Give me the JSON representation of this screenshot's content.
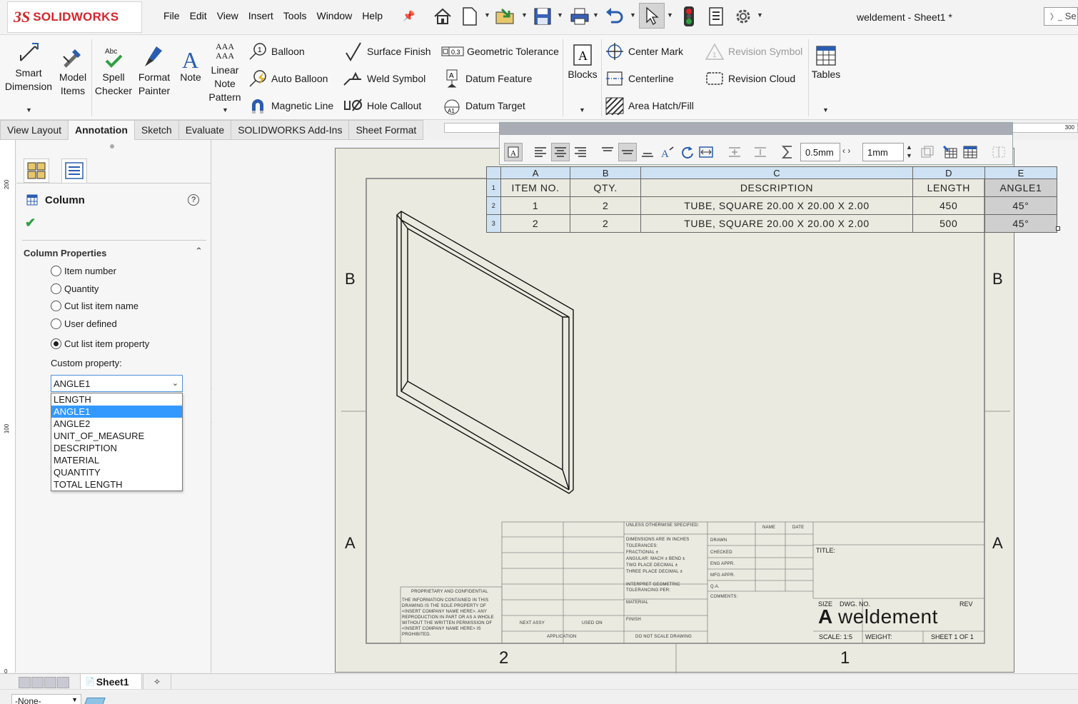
{
  "app": {
    "brand_mark": "3S",
    "brand": "SOLIDWORKS",
    "menu": [
      "File",
      "Edit",
      "View",
      "Insert",
      "Tools",
      "Window",
      "Help"
    ],
    "document_title": "weldement - Sheet1 *",
    "search_placeholder": "Se"
  },
  "ribbon": {
    "smart_dimension": [
      "Smart",
      "Dimension"
    ],
    "model_items": [
      "Model",
      "Items"
    ],
    "spell_checker": [
      "Spell",
      "Checker"
    ],
    "spell_icon_text": "Abc",
    "format_painter": [
      "Format",
      "Painter"
    ],
    "note": "Note",
    "linear_note_pattern": [
      "Linear",
      "Note",
      "Pattern"
    ],
    "note_icon_text": "AAA",
    "balloon": "Balloon",
    "auto_balloon": "Auto Balloon",
    "magnetic_line": "Magnetic Line",
    "surface_finish": "Surface Finish",
    "weld_symbol": "Weld Symbol",
    "hole_callout": "Hole Callout",
    "geometric_tolerance": "Geometric Tolerance",
    "geo_tol_icon_text": "0.3",
    "datum_feature": "Datum Feature",
    "datum_target": "Datum Target",
    "datum_target_icon_text": "A1",
    "blocks": "Blocks",
    "center_mark": "Center Mark",
    "centerline": "Centerline",
    "area_hatch": "Area Hatch/Fill",
    "revision_symbol": "Revision Symbol",
    "revision_cloud": "Revision Cloud",
    "tables": "Tables"
  },
  "tabs": [
    "View Layout",
    "Annotation",
    "Sketch",
    "Evaluate",
    "SOLIDWORKS Add-Ins",
    "Sheet Format"
  ],
  "active_tab": "Annotation",
  "property_manager": {
    "title": "Column",
    "help": "?",
    "section": "Column Properties",
    "options": [
      "Item number",
      "Quantity",
      "Cut list item name",
      "User defined",
      "Cut list item property"
    ],
    "selected_option": "Cut list item property",
    "custom_property_label": "Custom property:",
    "custom_property_value": "ANGLE1",
    "dropdown_options": [
      "LENGTH",
      "ANGLE1",
      "ANGLE2",
      "UNIT_OF_MEASURE",
      "DESCRIPTION",
      "MATERIAL",
      "QUANTITY",
      "TOTAL LENGTH"
    ],
    "dropdown_selected": "ANGLE1"
  },
  "table_toolbar": {
    "border_width": "0.5mm",
    "cell_padding": "1mm"
  },
  "bom_table": {
    "column_letters": [
      "A",
      "B",
      "C",
      "D",
      "E"
    ],
    "row_numbers": [
      "1",
      "2",
      "3"
    ],
    "headers": [
      "ITEM NO.",
      "QTY.",
      "DESCRIPTION",
      "LENGTH",
      "ANGLE1"
    ],
    "rows": [
      [
        "1",
        "2",
        "TUBE, SQUARE 20.00 X 20.00 X 2.00",
        "450",
        "45°"
      ],
      [
        "2",
        "2",
        "TUBE, SQUARE 20.00 X 20.00 X 2.00",
        "500",
        "45°"
      ]
    ]
  },
  "sheet": {
    "zone_letters": [
      "B",
      "A"
    ],
    "zone_numbers": [
      "2",
      "1"
    ],
    "title_block": {
      "unless": "UNLESS OTHERWISE SPECIFIED:",
      "name": "NAME",
      "date": "DATE",
      "dims": "DIMENSIONS ARE IN INCHES",
      "tolerances": "TOLERANCES:",
      "fractional": "FRACTIONAL ±",
      "angular": "ANGULAR: MACH ±   BEND ±",
      "two_place": "TWO PLACE DECIMAL   ±",
      "three_place": "THREE PLACE DECIMAL   ±",
      "interpret": "INTERPRET GEOMETRIC",
      "tol_per": "TOLERANCING PER:",
      "material": "MATERIAL",
      "finish": "FINISH",
      "drawn": "DRAWN",
      "checked": "CHECKED",
      "eng_appr": "ENG APPR.",
      "mfg_appr": "MFG APPR.",
      "qa": "Q.A.",
      "comments": "COMMENTS:",
      "title": "TITLE:",
      "size_label": "SIZE",
      "dwg_no_label": "DWG.  NO.",
      "rev": "REV",
      "size": "A",
      "dwg_no": "weldement",
      "scale": "SCALE: 1:5",
      "weight": "WEIGHT:",
      "sheet": "SHEET 1 OF 1",
      "next_assy": "NEXT ASSY",
      "used_on": "USED ON",
      "application": "APPLICATION",
      "do_not_scale": "DO NOT SCALE DRAWING",
      "proprietary": "PROPRIETARY AND CONFIDENTIAL",
      "prop_text": [
        "THE INFORMATION CONTAINED IN THIS",
        "DRAWING IS THE SOLE PROPERTY OF",
        "<INSERT COMPANY NAME HERE>. ANY",
        "REPRODUCTION IN PART OR AS A WHOLE",
        "WITHOUT THE WRITTEN PERMISSION OF",
        "<INSERT COMPANY NAME HERE> IS",
        "PROHIBITED."
      ]
    }
  },
  "rulers": {
    "top_300": "300",
    "left_200": "200",
    "left_100": "100",
    "left_0": "0"
  },
  "sheet_tab": "Sheet1",
  "status": {
    "layer": "-None-"
  }
}
